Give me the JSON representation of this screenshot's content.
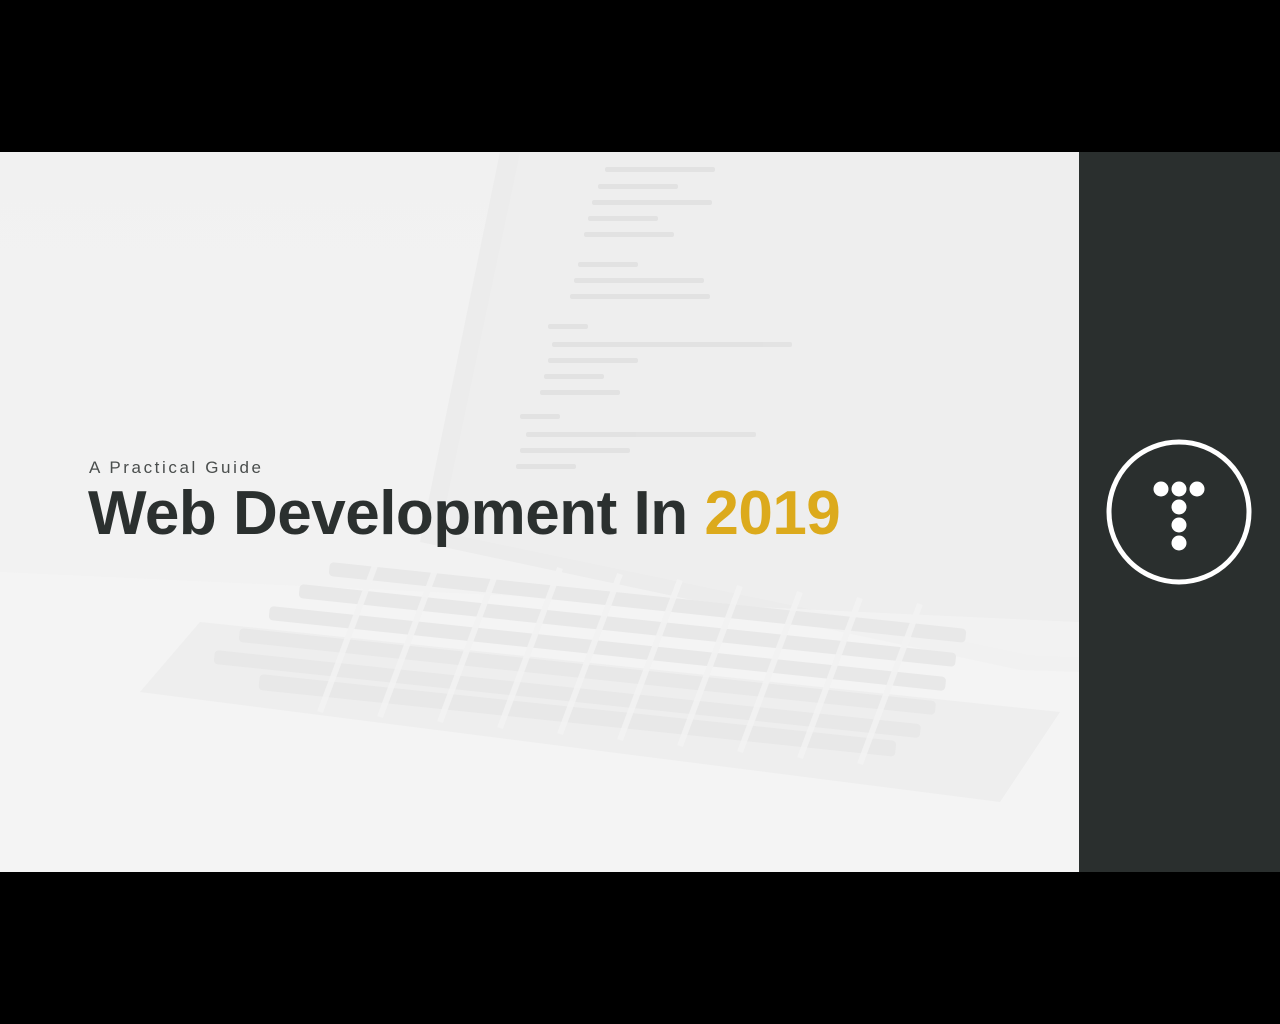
{
  "slide": {
    "subtitle": "A Practical Guide",
    "title_main": "Web Development In",
    "title_year": "2019"
  },
  "colors": {
    "background": "#000000",
    "hero_background": "#f2f2f2",
    "sidebar": "#2a2f2e",
    "title_text": "#2b302f",
    "accent_year": "#dcaa1c",
    "logo": "#ffffff"
  },
  "icons": {
    "logo": "treehouse-style-dotted-t-logo",
    "background_art": "faded-laptop-with-code-illustration"
  }
}
